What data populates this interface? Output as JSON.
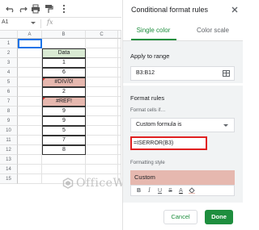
{
  "spreadsheet": {
    "name_box": "A1",
    "fx_label": "fx",
    "columns": [
      "A",
      "B",
      "C"
    ],
    "rows": [
      "1",
      "2",
      "3",
      "4",
      "5",
      "6",
      "7",
      "8",
      "9",
      "10",
      "11",
      "12",
      "13",
      "14",
      "15"
    ],
    "data": [
      {
        "value": "Data",
        "error": false,
        "header": true
      },
      {
        "value": "1",
        "error": false
      },
      {
        "value": "6",
        "error": false
      },
      {
        "value": "#DIV/0!",
        "error": true
      },
      {
        "value": "2",
        "error": false
      },
      {
        "value": "#REF!",
        "error": true
      },
      {
        "value": "9",
        "error": false
      },
      {
        "value": "9",
        "error": false
      },
      {
        "value": "5",
        "error": false
      },
      {
        "value": "7",
        "error": false
      },
      {
        "value": "8",
        "error": false
      }
    ],
    "header_fill": "#d9ead3",
    "error_fill": "#e6b8af"
  },
  "watermark": {
    "text": "OfficeWheel"
  },
  "panel": {
    "title": "Conditional format rules",
    "tabs": [
      {
        "label": "Single color",
        "active": true
      },
      {
        "label": "Color scale",
        "active": false
      }
    ],
    "apply_label": "Apply to range",
    "range_value": "B3:B12",
    "rules_label": "Format rules",
    "cells_if_label": "Format cells if…",
    "condition_value": "Custom formula is",
    "formula_value": "=ISERROR(B3)",
    "style_label": "Formatting style",
    "style_preview": "Custom",
    "format_buttons": [
      "B",
      "I",
      "U",
      "S",
      "A",
      "fill"
    ],
    "cancel_label": "Cancel",
    "done_label": "Done",
    "accent": "#1e8e3e"
  }
}
